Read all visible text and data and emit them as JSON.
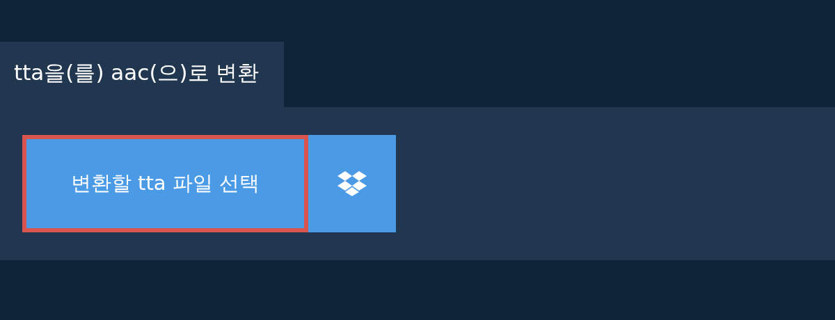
{
  "tab": {
    "label": "tta을(를) aac(으)로 변환",
    "selected": true
  },
  "upload_button": {
    "label": "변환할 tta 파일 선택",
    "focused": true
  }
}
